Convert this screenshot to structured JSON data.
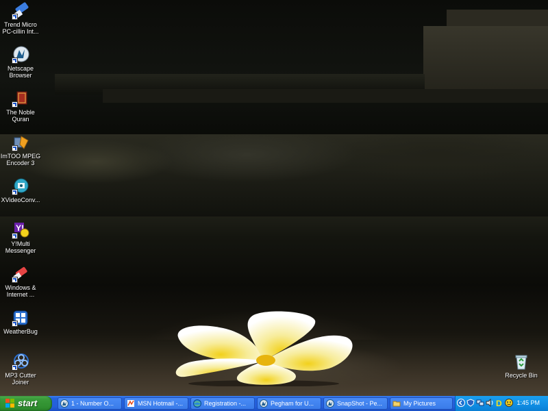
{
  "desktop": {
    "icons": [
      {
        "label": "Trend Micro PC-cillin Int...",
        "icon": "trend-micro-icon"
      },
      {
        "label": "Netscape Browser",
        "icon": "netscape-icon"
      },
      {
        "label": "The Noble Quran",
        "icon": "quran-book-icon"
      },
      {
        "label": "ImTOO MPEG Encoder 3",
        "icon": "imtoo-encoder-icon"
      },
      {
        "label": "XVideoConv...",
        "icon": "xvideo-converter-icon"
      },
      {
        "label": "Y!Multi Messenger",
        "icon": "yahoo-messenger-icon"
      },
      {
        "label": "Windows & Internet ...",
        "icon": "eraser-icon"
      },
      {
        "label": "WeatherBug",
        "icon": "weatherbug-icon"
      },
      {
        "label": "MP3 Cutter Joiner",
        "icon": "biohazard-icon"
      }
    ],
    "recycle_bin": {
      "label": "Recycle Bin",
      "icon": "recycle-bin-icon"
    }
  },
  "taskbar": {
    "start_label": "start",
    "buttons": [
      {
        "label": "1 - Number O...",
        "icon": "netscape-icon"
      },
      {
        "label": "MSN Hotmail -...",
        "icon": "msn-icon"
      },
      {
        "label": "Registration -...",
        "icon": "globe-icon"
      },
      {
        "label": "Pegham for U...",
        "icon": "netscape-icon"
      },
      {
        "label": "SnapShot - Pe...",
        "icon": "netscape-icon"
      },
      {
        "label": "My Pictures",
        "icon": "folder-icon"
      }
    ],
    "tray": {
      "clock": "1:45 PM",
      "icons": [
        "collapse-arrow-icon",
        "security-icon",
        "network-icon",
        "speaker-icon",
        "download-icon",
        "messenger-icon"
      ]
    }
  },
  "colors": {
    "taskbar": "#245edb",
    "start": "#3a9b3a",
    "tray": "#0f8ae0"
  }
}
